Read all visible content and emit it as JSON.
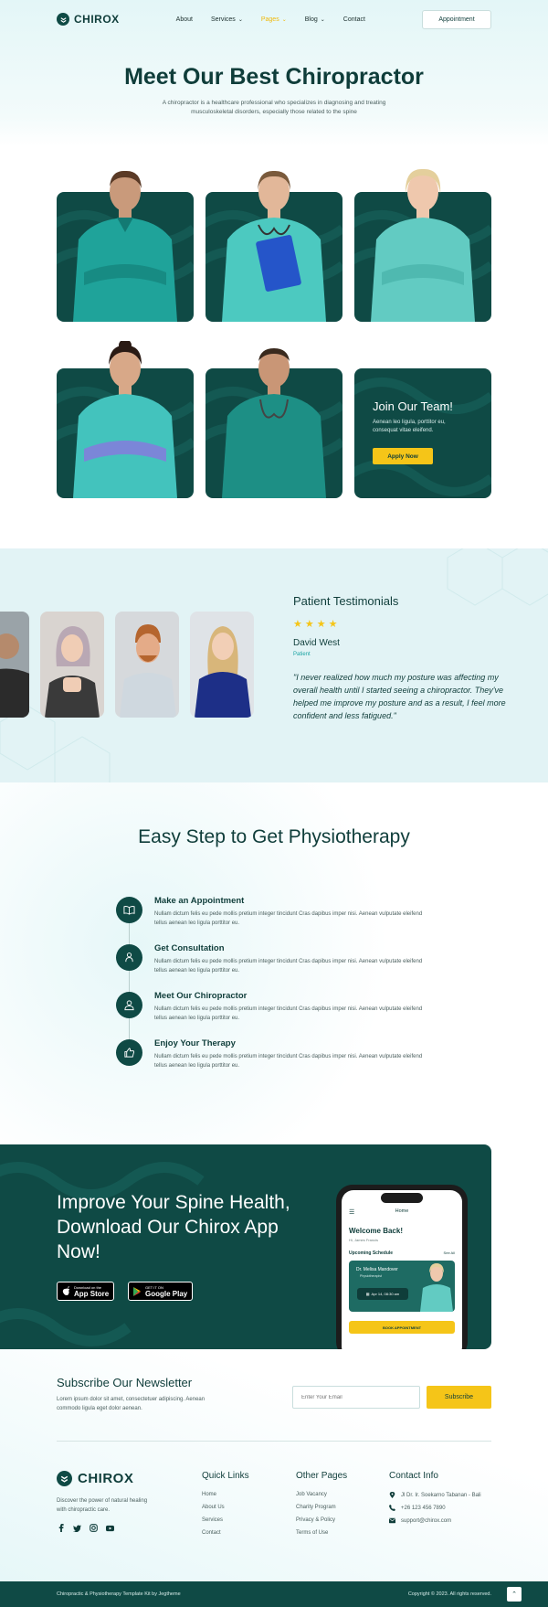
{
  "header": {
    "logo": "CHIROX",
    "nav": [
      "About",
      "Services",
      "Pages",
      "Blog",
      "Contact"
    ],
    "nav_dropdowns": [
      "Services",
      "Pages",
      "Blog"
    ],
    "nav_active": "Pages",
    "cta": "Appointment"
  },
  "hero": {
    "title": "Meet Our Best Chiropractor",
    "subtitle": "A chiropractor is a healthcare professional who specializes in diagnosing and treating musculoskeletal disorders, especially those related to the spine"
  },
  "team": {
    "join_title": "Join Our Team!",
    "join_text": "Aenean leo ligula, porttitor eu, consequat vitae eleifend.",
    "apply_label": "Apply Now"
  },
  "testimonials": {
    "title": "Patient Testimonials",
    "stars": "★★★★",
    "name": "David West",
    "role": "Patient",
    "quote": "\"I never realized how much my posture was affecting my overall health until I started seeing a chiropractor. They've helped me improve my posture and as a result, I feel more confident and less fatigued.\""
  },
  "steps": {
    "title": "Easy Step to Get Physiotherapy",
    "items": [
      {
        "title": "Make an Appointment",
        "text": "Nullam dictum felis eu pede mollis pretium integer tincidunt Cras dapibus imper nisi. Aenean vulputate eleifend tellus aenean leo ligula porttitor eu."
      },
      {
        "title": "Get Consultation",
        "text": "Nullam dictum felis eu pede mollis pretium integer tincidunt Cras dapibus imper nisi. Aenean vulputate eleifend tellus aenean leo ligula porttitor eu."
      },
      {
        "title": "Meet Our Chiropractor",
        "text": "Nullam dictum felis eu pede mollis pretium integer tincidunt Cras dapibus imper nisi. Aenean vulputate eleifend tellus aenean leo ligula porttitor eu."
      },
      {
        "title": "Enjoy Your Therapy",
        "text": "Nullam dictum felis eu pede mollis pretium integer tincidunt Cras dapibus imper nisi. Aenean vulputate eleifend tellus aenean leo ligula porttitor eu."
      }
    ]
  },
  "app": {
    "title": "Improve Your Spine Health, Download Our Chirox App Now!",
    "appstore_small": "Download on the",
    "appstore_big": "App Store",
    "googleplay_small": "GET IT ON",
    "googleplay_big": "Google Play",
    "phone": {
      "home": "Home",
      "welcome": "Welcome Back!",
      "hi": "Hi, James Francis",
      "upcoming": "Upcoming Schedule",
      "see_all": "See All",
      "doctor": "Dr. Melisa Mandover",
      "specialty": "Physiotherapist",
      "time": "Apr 14, 08:30 am",
      "book": "BOOK APPOINTMENT"
    }
  },
  "newsletter": {
    "title": "Subscribe Our Newsletter",
    "text": "Lorem ipsum dolor sit amet, consectetuer adipiscing. Aenean commodo ligula eget dolor aenean.",
    "placeholder": "Enter Your Email",
    "button": "Subscribe"
  },
  "footer": {
    "logo": "CHIROX",
    "desc": "Discover the power of natural healing with chiropractic care.",
    "quick_links_title": "Quick Links",
    "quick_links": [
      "Home",
      "About Us",
      "Services",
      "Contact"
    ],
    "other_pages_title": "Other Pages",
    "other_pages": [
      "Job Vacancy",
      "Charity Program",
      "Privacy & Policy",
      "Terms of Use"
    ],
    "contact_title": "Contact Info",
    "address": "Jl Dr. Ir. Soekarno Tabanan - Bali",
    "phone": "+26 123 456 7890",
    "email": "support@chirox.com",
    "copyright_left": "Chiropractic & Physiotherapy Template Kit by Jegtheme",
    "copyright_right": "Copyright © 2023. All rights reserved."
  },
  "colors": {
    "primary": "#0f4a45",
    "accent": "#f5c518",
    "light_bg": "#e2f3f5"
  }
}
